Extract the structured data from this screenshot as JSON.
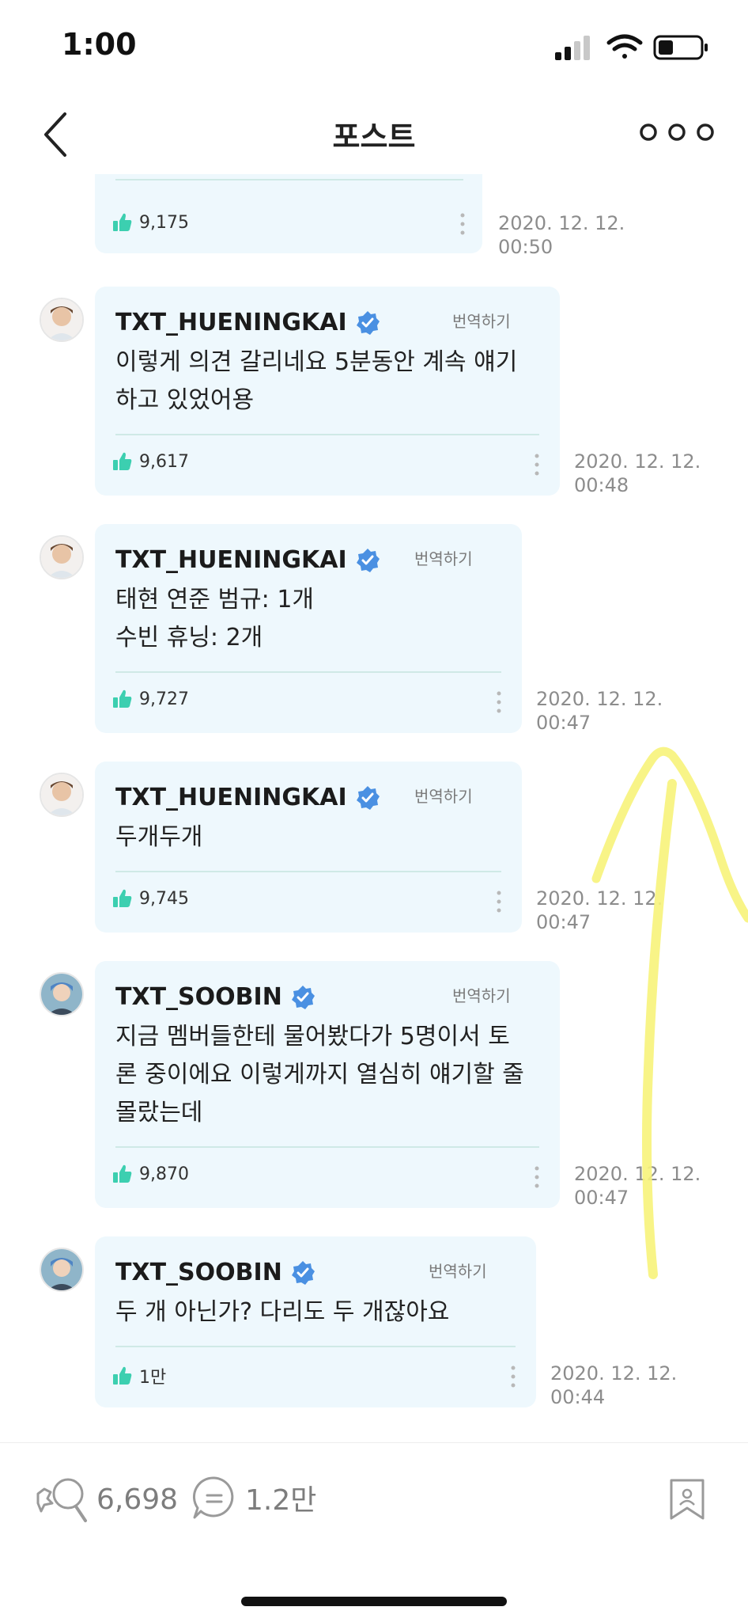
{
  "status_bar": {
    "time": "1:00"
  },
  "nav": {
    "title": "포스트"
  },
  "posts": [
    {
      "author": "",
      "translate": "",
      "text": "",
      "likes": "9,175",
      "timestamp": "2020. 12. 12.\n00:50"
    },
    {
      "author": "TXT_HUENINGKAI",
      "translate": "번역하기",
      "text": "이렇게 의견 갈리네요 5분동안 계속 얘기\n하고 있었어용",
      "likes": "9,617",
      "timestamp": "2020. 12. 12.\n00:48"
    },
    {
      "author": "TXT_HUENINGKAI",
      "translate": "번역하기",
      "text": "태현 연준 범규: 1개\n수빈 휴닝: 2개",
      "likes": "9,727",
      "timestamp": "2020. 12. 12.\n00:47"
    },
    {
      "author": "TXT_HUENINGKAI",
      "translate": "번역하기",
      "text": "두개두개",
      "likes": "9,745",
      "timestamp": "2020. 12. 12.\n00:47"
    },
    {
      "author": "TXT_SOOBIN",
      "translate": "번역하기",
      "text": "지금 멤버들한테 물어봤다가 5명이서 토\n론 중이에요 이렇게까지 열심히 얘기할 줄\n몰랐는데",
      "likes": "9,870",
      "timestamp": "2020. 12. 12.\n00:47"
    },
    {
      "author": "TXT_SOOBIN",
      "translate": "번역하기",
      "text": "두 개 아닌가? 다리도 두 개잖아요",
      "likes": "1만",
      "timestamp": "2020. 12. 12.\n00:44"
    }
  ],
  "bottom_bar": {
    "likes_count": "6,698",
    "comments_count": "1.2만"
  },
  "colors": {
    "bubble": "#eef8fd",
    "thumb": "#3ccfb0",
    "verified": "#4a90e2",
    "marker": "#f7f37a"
  },
  "icons": [
    "back-chevron-icon",
    "more-dots-icon",
    "verified-badge-icon",
    "thumbs-up-icon",
    "kebab-icon",
    "like-icon",
    "comment-icon",
    "bookmark-icon"
  ]
}
